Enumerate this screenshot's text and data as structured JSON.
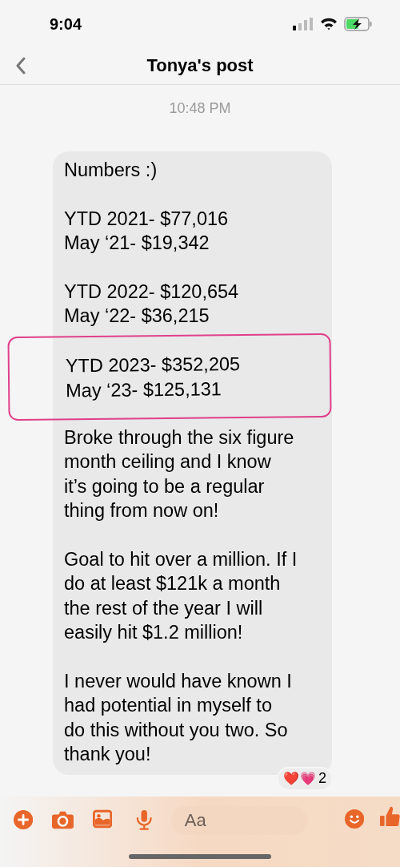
{
  "status_bar": {
    "time": "9:04"
  },
  "header": {
    "title": "Tonya's post"
  },
  "timestamp": "10:48 PM",
  "message": {
    "paragraphs": [
      {
        "kind": "text",
        "lines": [
          "Numbers :)"
        ],
        "highlighted": false
      },
      {
        "kind": "text",
        "lines": [
          "YTD 2021- $77,016",
          "May ‘21- $19,342"
        ],
        "highlighted": false
      },
      {
        "kind": "text",
        "lines": [
          "YTD 2022- $120,654",
          "May ‘22- $36,215"
        ],
        "highlighted": false
      },
      {
        "kind": "text",
        "lines": [
          "YTD 2023- $352,205",
          "May ‘23- $125,131"
        ],
        "highlighted": true
      },
      {
        "kind": "text",
        "lines": [
          "Broke through the six figure\nmonth ceiling and I know\nit’s going to be a regular\nthing from now on!"
        ],
        "highlighted": false
      },
      {
        "kind": "text",
        "lines": [
          "Goal to hit over a million. If I\ndo at least $121k a month\nthe rest of the year I will\neasily hit $1.2 million!"
        ],
        "highlighted": false
      },
      {
        "kind": "text",
        "lines": [
          "I never would have known I\nhad potential in myself to\ndo this without you two. So\nthank you!"
        ],
        "highlighted": false
      }
    ],
    "reactions": {
      "emojis": [
        "❤️",
        "💗"
      ],
      "count": "2"
    }
  },
  "composer": {
    "placeholder": "Aa"
  }
}
